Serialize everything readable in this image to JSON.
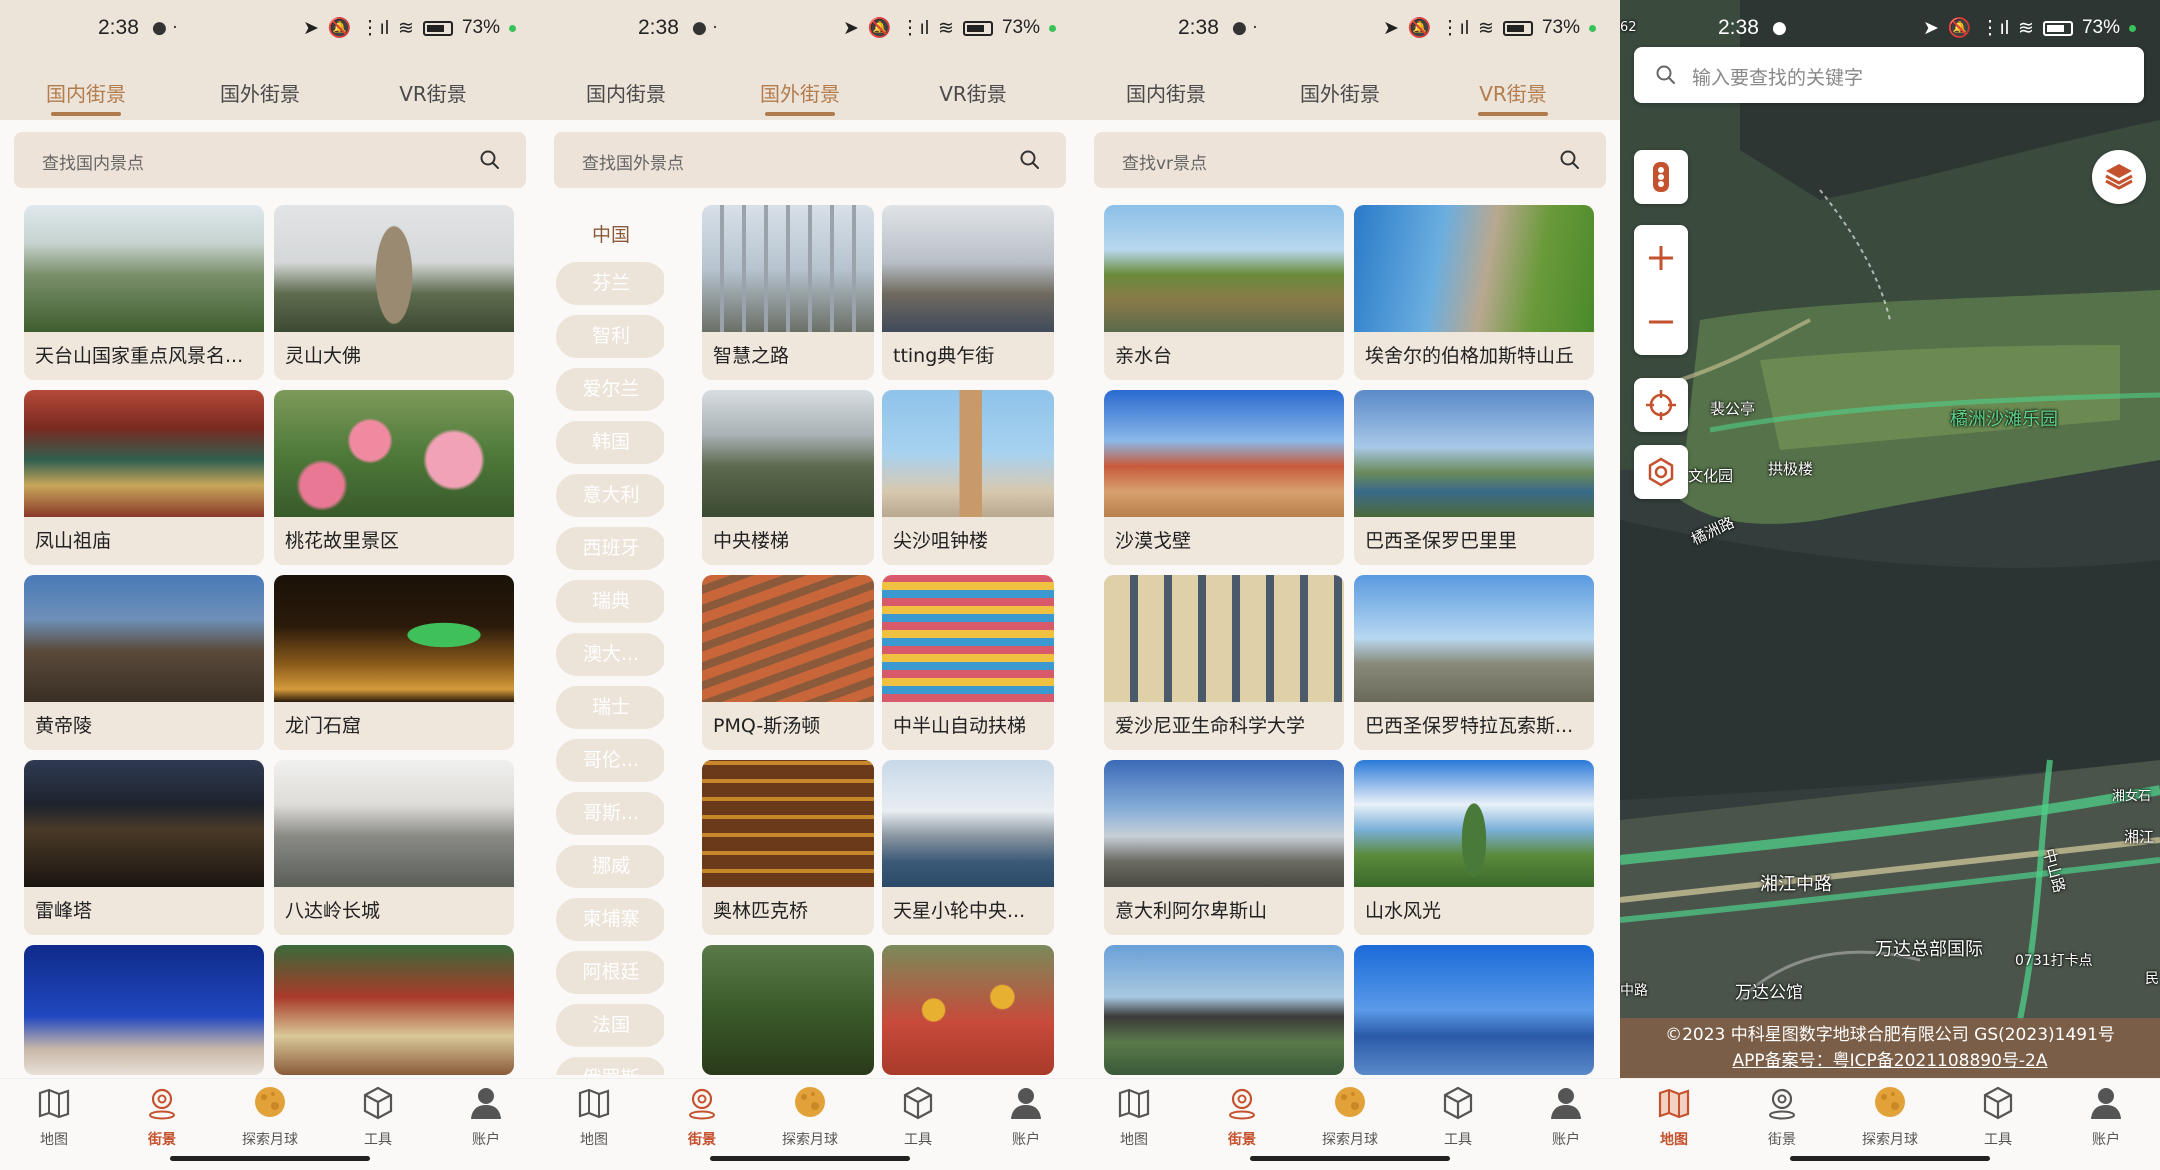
{
  "status": {
    "time": "2:38",
    "battery": "73%"
  },
  "tabs": [
    "国内街景",
    "国外街景",
    "VR街景"
  ],
  "panel1": {
    "search_placeholder": "查找国内景点",
    "cards": [
      "天台山国家重点风景名...",
      "灵山大佛",
      "凤山祖庙",
      "桃花故里景区",
      "黄帝陵",
      "龙门石窟",
      "雷峰塔",
      "八达岭长城"
    ]
  },
  "panel2": {
    "search_placeholder": "查找国外景点",
    "countries": [
      "中国",
      "芬兰",
      "智利",
      "爱尔兰",
      "韩国",
      "意大利",
      "西班牙",
      "瑞典",
      "澳大...",
      "瑞士",
      "哥伦...",
      "哥斯...",
      "挪威",
      "柬埔寨",
      "阿根廷",
      "法国",
      "俄罗斯"
    ],
    "cards": [
      "智慧之路",
      "tting典乍街",
      "中央楼梯",
      "尖沙咀钟楼",
      "PMQ-斯汤顿",
      "中半山自动扶梯",
      "奥林匹克桥",
      "天星小轮中央..."
    ]
  },
  "panel3": {
    "search_placeholder": "查找vr景点",
    "cards": [
      "亲水台",
      "埃舍尔的伯格加斯特山丘",
      "沙漠戈壁",
      "巴西圣保罗巴里里",
      "爱沙尼亚生命科学大学",
      "巴西圣保罗特拉瓦索斯...",
      "意大利阿尔卑斯山",
      "山水风光"
    ]
  },
  "map": {
    "search_placeholder": "输入要查找的关键字",
    "labels": [
      "裴公亭",
      "拱极楼",
      "文化园",
      "橘洲沙滩乐园",
      "橘洲路",
      "湘江中路",
      "中山路",
      "万达总部国际",
      "0731打卡点",
      "万达公馆",
      "湘女石",
      "湘江",
      "中路",
      "民",
      "62"
    ],
    "copyright": "©2023 中科星图数字地球合肥有限公司 GS(2023)1491号",
    "icp": "APP备案号：粤ICP备2021108890号-2A"
  },
  "nav": [
    "地图",
    "街景",
    "探索月球",
    "工具",
    "账户"
  ],
  "colors": {
    "accent": "#b37c4d",
    "active_nav": "#c4522e",
    "chip_bg": "#ece3d9",
    "header_bg": "#ece3d9"
  }
}
